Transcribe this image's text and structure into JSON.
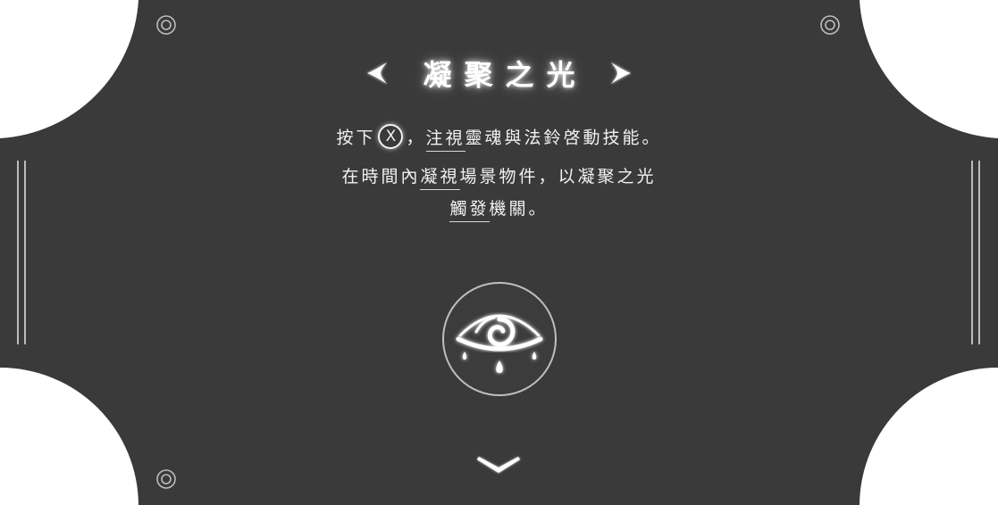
{
  "title": {
    "text": "凝聚之光"
  },
  "instructions": {
    "line1": {
      "before": "按下",
      "button_glyph": "X",
      "after_a": "，",
      "underlined": "注視",
      "after_b": "靈魂與法鈴啓動技能。"
    },
    "line2": {
      "before": "在時間內",
      "underlined": "凝視",
      "after": "場景物件，以凝聚之光"
    },
    "line3": {
      "underlined": "觸發",
      "after": "機關。"
    }
  },
  "icons": {
    "title_left": "chevron-left-icon",
    "title_right": "chevron-right-icon",
    "skill": "weeping-eye-icon",
    "scroll": "chevron-down-icon",
    "corner_rivet": "rivet-icon"
  },
  "colors": {
    "panel": "#3a3a3a",
    "text": "#f2f2f2",
    "glow": "#ffffff",
    "background": "#ffffff"
  }
}
